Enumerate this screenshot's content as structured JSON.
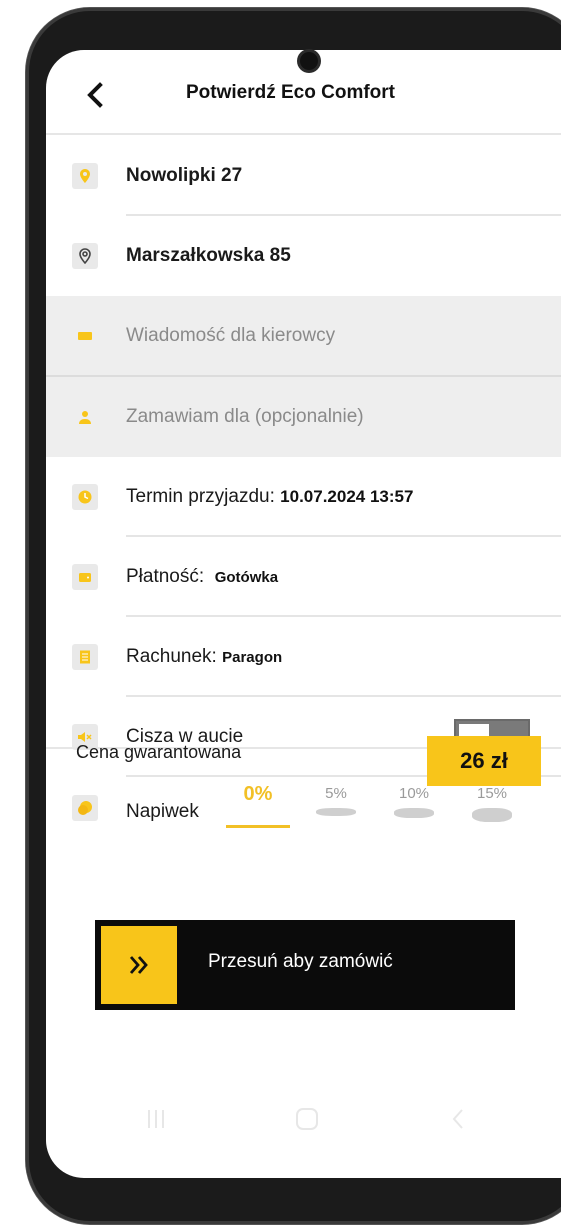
{
  "header": {
    "title": "Potwierdź Eco Comfort"
  },
  "route": {
    "pickup": "Nowolipki 27",
    "destination": "Marszałkowska 85"
  },
  "fields": {
    "driver_message_placeholder": "Wiadomość dla kierowcy",
    "order_for_placeholder": "Zamawiam dla (opcjonalnie)"
  },
  "details": {
    "arrival_label": "Termin przyjazdu:",
    "arrival_value": "10.07.2024 13:57",
    "payment_label": "Płatność:",
    "payment_value": "Gotówka",
    "receipt_label": "Rachunek:",
    "receipt_value": "Paragon",
    "quiet_label": "Cisza w aucie",
    "quiet_enabled": false,
    "tip_label": "Napiwek",
    "tip_options": [
      "0%",
      "5%",
      "10%",
      "15%"
    ],
    "tip_selected": "0%"
  },
  "price": {
    "label": "Cena gwarantowana",
    "value": "26 zł"
  },
  "slider": {
    "label": "Przesuń aby zamówić"
  },
  "colors": {
    "accent": "#f8c51a",
    "dark": "#0b0b0b",
    "muted": "#8a8a8a"
  },
  "icons": {
    "back": "chevron-left-icon",
    "pickup": "location-pin-icon",
    "destination": "location-pin-icon",
    "message": "chat-bubble-icon",
    "order_for": "person-icon",
    "arrival": "clock-icon",
    "payment": "wallet-icon",
    "receipt": "receipt-icon",
    "quiet": "speaker-mute-icon",
    "tip": "coins-icon",
    "slider": "double-chevron-right-icon"
  }
}
